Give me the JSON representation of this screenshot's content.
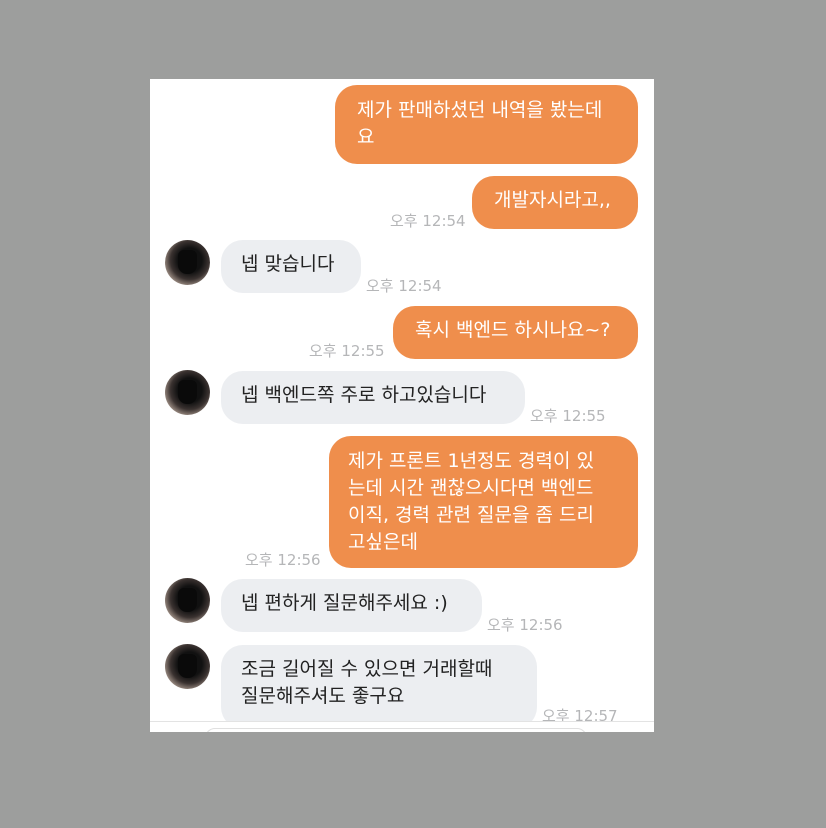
{
  "messages": [
    {
      "text": "제가 판매하셨던 내역을 봤는데\n요",
      "sender": "me"
    },
    {
      "text": "개발자시라고,,",
      "sender": "me",
      "time": "오후 12:54"
    },
    {
      "text": "넵 맞습니다",
      "sender": "other",
      "time": "오후 12:54"
    },
    {
      "text": "혹시 백엔드 하시나요~?",
      "sender": "me",
      "time": "오후 12:55"
    },
    {
      "text": "넵 백엔드쪽 주로 하고있습니다",
      "sender": "other",
      "time": "오후 12:55"
    },
    {
      "text": "제가 프론트 1년정도 경력이 있\n는데 시간 괜찮으시다면 백엔드\n이직, 경력 관련 질문을 좀 드리\n고싶은데",
      "sender": "me",
      "time": "오후 12:56"
    },
    {
      "text": "넵 편하게 질문해주세요 :)",
      "sender": "other",
      "time": "오후 12:56"
    },
    {
      "text": "조금 길어질 수 있으면 거래할때\n질문해주셔도 좋구요",
      "sender": "other",
      "time": "오후 12:57"
    }
  ],
  "colors": {
    "outgoing": "#ef8e4c",
    "incoming": "#eceef1",
    "background": "#9d9e9d"
  }
}
